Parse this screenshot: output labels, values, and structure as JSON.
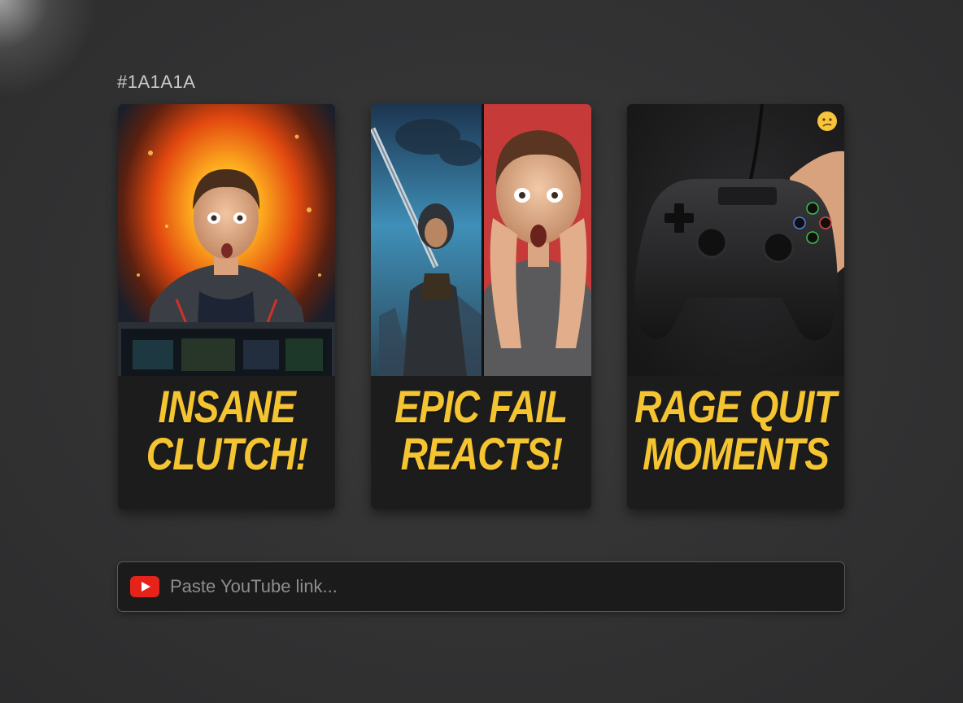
{
  "canvas": {
    "color_label": "#1A1A1A"
  },
  "cards": [
    {
      "line1": "INSANE",
      "line2": "CLUTCH!",
      "thumbnail_icon": "explosion-reaction-thumbnail"
    },
    {
      "line1": "EPIC FAIL",
      "line2": "REACTS!",
      "thumbnail_icon": "sword-warrior-split-reaction-thumbnail"
    },
    {
      "line1": "RAGE QUIT",
      "line2": "MOMENTS",
      "thumbnail_icon": "game-controller-thumbnail",
      "badge_icon": "confused-face-emoji"
    }
  ],
  "search": {
    "placeholder": "Paste YouTube link...",
    "value": "",
    "icon": "youtube-icon"
  },
  "colors": {
    "caption_yellow": "#f5c431",
    "card_bg": "#1c1c1d",
    "page_bg": "#333334",
    "youtube_red": "#e5231b"
  }
}
